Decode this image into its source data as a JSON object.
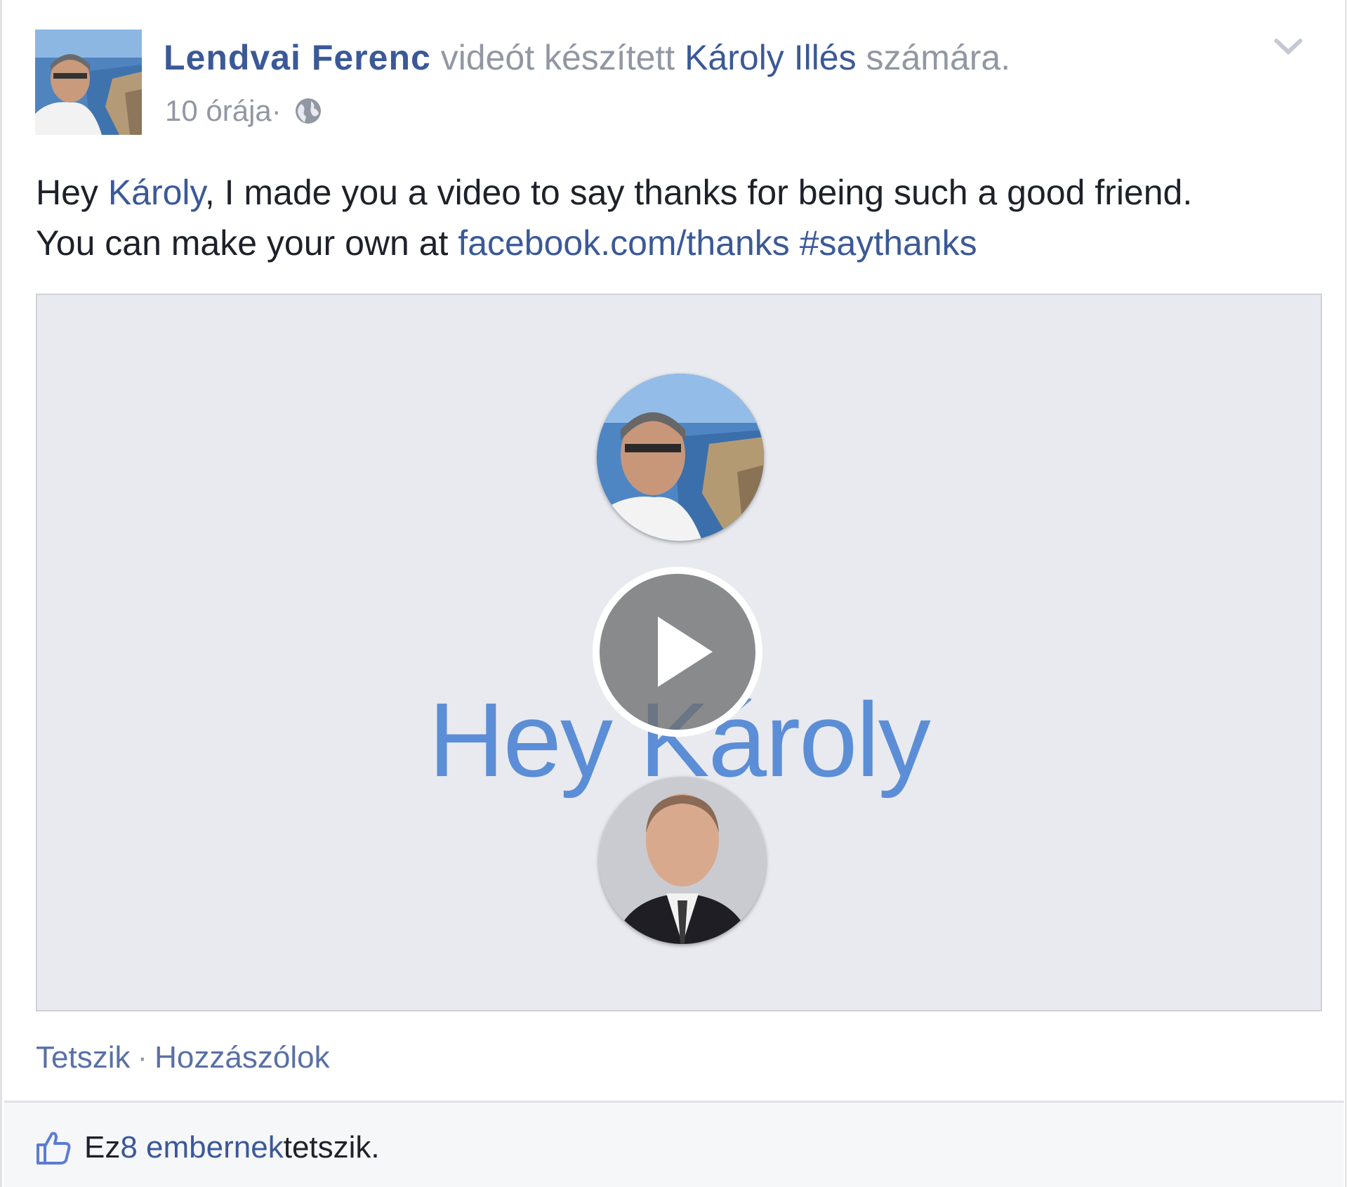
{
  "post": {
    "author": "Lendvai Ferenc",
    "action_text": " videót készített ",
    "target": "Károly Illés",
    "suffix": " számára.",
    "timestamp": "10 órája",
    "separator": " · ",
    "privacy_icon": "globe-icon",
    "menu_icon": "chevron-down-icon"
  },
  "message": {
    "line1_prefix": "Hey ",
    "line1_mention": "Károly",
    "line1_suffix": ", I made you a video to say thanks for being such a good friend.",
    "line2_prefix": "You can make your own at ",
    "line2_link": "facebook.com/thanks",
    "line2_space": " ",
    "line2_hashtag": "#saythanks"
  },
  "video": {
    "overlay_text": "Hey Károly",
    "play_icon": "play-icon"
  },
  "actions": {
    "like": "Tetszik",
    "separator": "·",
    "comment": "Hozzászólok"
  },
  "likes": {
    "icon": "thumbs-up-icon",
    "prefix": "Ez ",
    "link": "8 embernek",
    "suffix": " tetszik."
  },
  "colors": {
    "link_blue": "#3b5998",
    "muted_gray": "#9197a3",
    "video_bg": "#e9eaef",
    "overlay_text_blue": "#5b8ed6"
  }
}
